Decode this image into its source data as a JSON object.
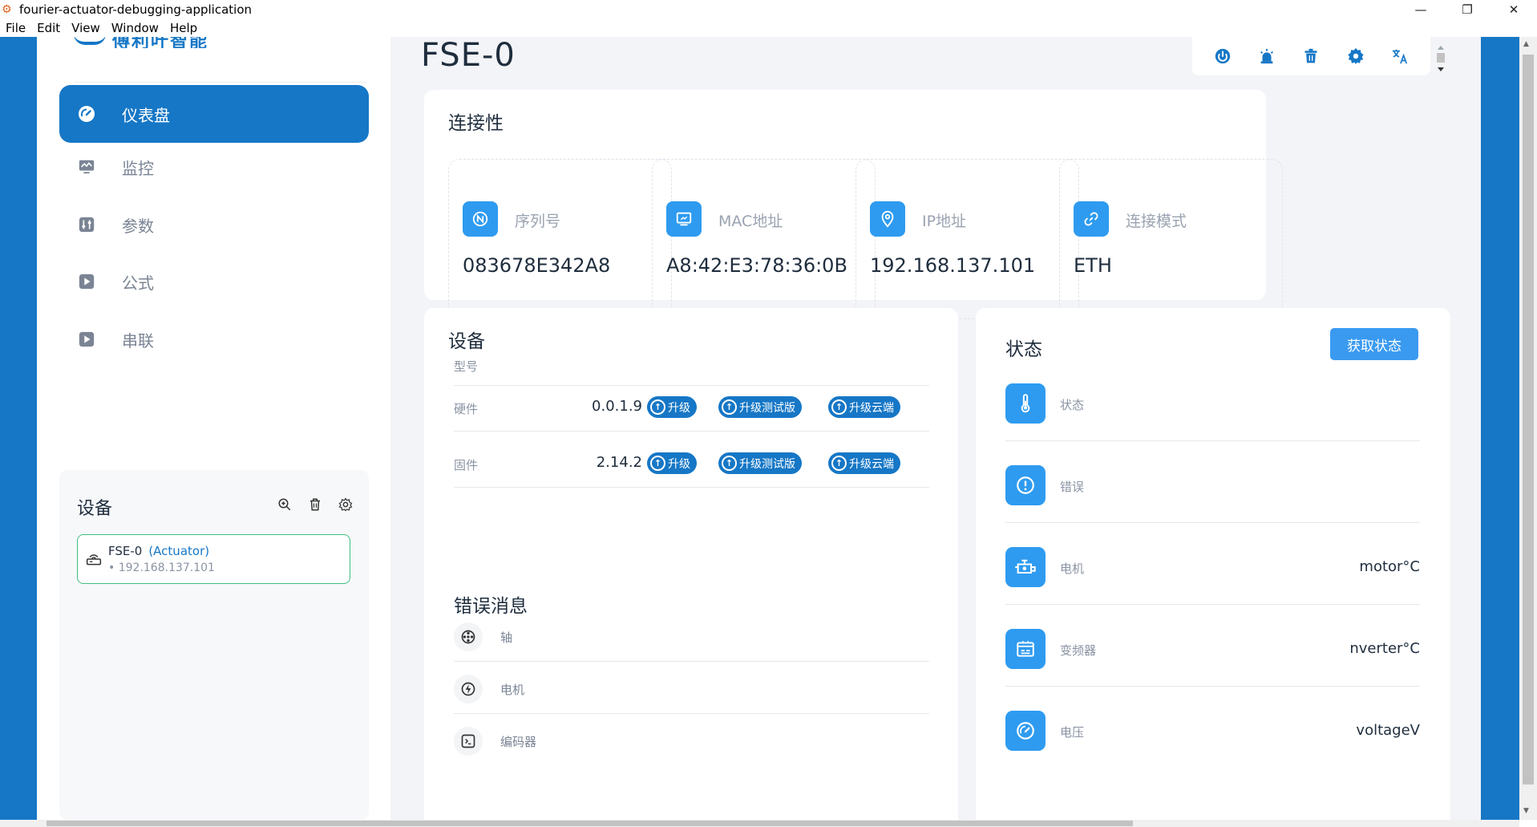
{
  "window": {
    "title": "fourier-actuator-debugging-application",
    "controls": [
      "—",
      "❐",
      "✕"
    ],
    "menu": [
      "File",
      "Edit",
      "View",
      "Window",
      "Help"
    ]
  },
  "sidebar": {
    "nav": [
      {
        "label": "仪表盘",
        "icon": "dashboard-icon",
        "active": true
      },
      {
        "label": "监控",
        "icon": "monitor-icon",
        "active": false
      },
      {
        "label": "参数",
        "icon": "parameters-icon",
        "active": false
      },
      {
        "label": "公式",
        "icon": "play-icon",
        "active": false
      },
      {
        "label": "串联",
        "icon": "play-icon",
        "active": false
      }
    ],
    "devices_panel": {
      "title": "设备",
      "device": {
        "name": "FSE-0",
        "type": "(Actuator)",
        "ip": "192.168.137.101"
      }
    }
  },
  "main": {
    "page_title": "FSE-0",
    "toolbar_icons": [
      "power-icon",
      "alarm-icon",
      "trash-icon",
      "settings-icon",
      "translate-icon"
    ],
    "connectivity": {
      "title": "连接性",
      "items": [
        {
          "label": "序列号",
          "value": "083678E342A8",
          "icon": "serial-icon"
        },
        {
          "label": "MAC地址",
          "value": "A8:42:E3:78:36:0B",
          "icon": "mac-icon"
        },
        {
          "label": "IP地址",
          "value": "192.168.137.101",
          "icon": "location-icon"
        },
        {
          "label": "连接模式",
          "value": "ETH",
          "icon": "link-icon"
        }
      ]
    },
    "device": {
      "title": "设备",
      "model_label": "型号",
      "rows": [
        {
          "label": "硬件",
          "version": "0.0.1.9",
          "buttons": [
            "升级",
            "升级测试版",
            "升级云端"
          ]
        },
        {
          "label": "固件",
          "version": "2.14.2",
          "buttons": [
            "升级",
            "升级测试版",
            "升级云端"
          ]
        }
      ],
      "errors_title": "错误消息",
      "errors": [
        {
          "label": "轴",
          "icon": "axis-icon"
        },
        {
          "label": "电机",
          "icon": "lightning-icon"
        },
        {
          "label": "编码器",
          "icon": "terminal-icon"
        }
      ]
    },
    "status": {
      "title": "状态",
      "fetch_button": "获取状态",
      "rows": [
        {
          "label": "状态",
          "value": "",
          "icon": "thermometer-icon"
        },
        {
          "label": "错误",
          "value": "",
          "icon": "alert-icon"
        },
        {
          "label": "电机",
          "value": "motor°C",
          "icon": "engine-icon"
        },
        {
          "label": "变频器",
          "value": "nverter°C",
          "icon": "inverter-icon"
        },
        {
          "label": "电压",
          "value": "voltageV",
          "icon": "gauge-icon"
        }
      ]
    }
  },
  "colors": {
    "primary": "#1677c6",
    "accent": "#2e9bf0",
    "success_border": "#3fbf7f",
    "background": "#f3f4f8"
  }
}
